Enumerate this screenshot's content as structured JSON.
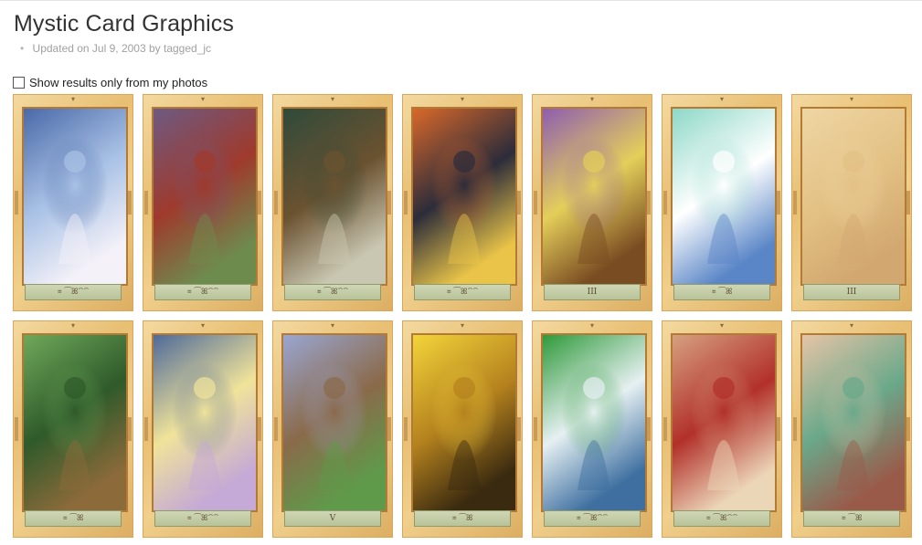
{
  "header": {
    "title": "Mystic Card Graphics",
    "updated": "Updated on Jul 9, 2003 by tagged_jc"
  },
  "filter": {
    "label": "Show results only from my photos",
    "checked": false
  },
  "cards": [
    {
      "id": "card-star",
      "banner": "꓿  ⁀ꕤ⁀⁀",
      "colors": [
        "#4a69a8",
        "#a9c2e6",
        "#f4f1f8"
      ]
    },
    {
      "id": "card-ruler",
      "banner": "꓿  ⁀ꕤ⁀⁀",
      "colors": [
        "#6d5a82",
        "#9f3a2c",
        "#6e8b4e"
      ]
    },
    {
      "id": "card-death",
      "banner": "꓿  ⁀ꕤ⁀⁀",
      "colors": [
        "#2f4a3a",
        "#6b5230",
        "#c9c7b2"
      ]
    },
    {
      "id": "card-chariot",
      "banner": "꓿  ⁀ꕤ⁀⁀",
      "colors": [
        "#d9682a",
        "#2c2c3a",
        "#e9c448"
      ]
    },
    {
      "id": "card-wheel",
      "banner": "III",
      "colors": [
        "#8e5db0",
        "#e4cf5a",
        "#7a4c22"
      ]
    },
    {
      "id": "card-spirit",
      "banner": "꓿  ⁀ꕤ",
      "colors": [
        "#8ed8c8",
        "#ffffff",
        "#5a86c7"
      ]
    },
    {
      "id": "card-blank",
      "banner": "III",
      "colors": [
        "#efd6a4",
        "#e3c184",
        "#d2a870"
      ]
    },
    {
      "id": "card-tree",
      "banner": "꓿  ⁀ꕤ",
      "colors": [
        "#6fa85a",
        "#2f5a2a",
        "#8c6a3a"
      ]
    },
    {
      "id": "card-hanged",
      "banner": "꓿  ⁀ꕤ⁀⁀",
      "colors": [
        "#4f6a9a",
        "#f0e39a",
        "#c5a9d6"
      ]
    },
    {
      "id": "card-tower",
      "banner": "V",
      "colors": [
        "#9aa6d2",
        "#8a6a4a",
        "#5f9a4a"
      ]
    },
    {
      "id": "card-sun",
      "banner": "꓿  ⁀ꕤ",
      "colors": [
        "#f3d43a",
        "#b5821e",
        "#3a2a10"
      ]
    },
    {
      "id": "card-dragon",
      "banner": "꓿  ⁀ꕤ⁀⁀",
      "colors": [
        "#2f9a3a",
        "#e6f0f2",
        "#3e6fa0"
      ]
    },
    {
      "id": "card-warrior",
      "banner": "꓿  ⁀ꕤ⁀⁀",
      "colors": [
        "#d6a080",
        "#b2302a",
        "#ecd6b8"
      ]
    },
    {
      "id": "card-dancer",
      "banner": "꓿  ⁀ꕤ",
      "colors": [
        "#e6c4a6",
        "#6aa88a",
        "#9a5a4a"
      ]
    }
  ]
}
